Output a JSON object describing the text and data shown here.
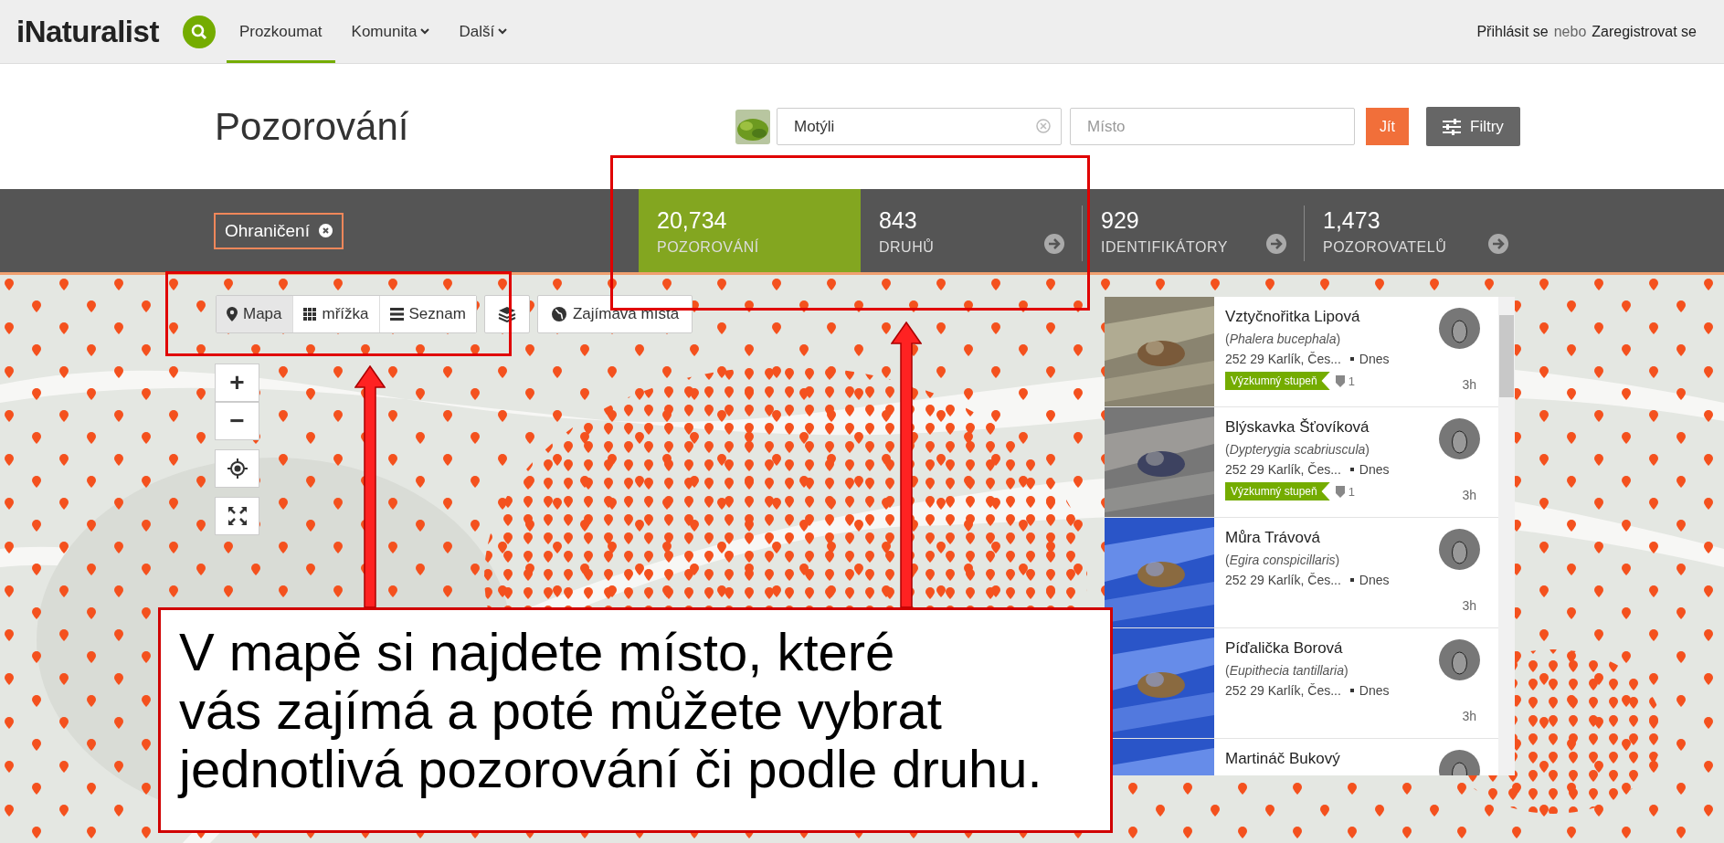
{
  "nav": {
    "logo": "iNaturalist",
    "items": [
      {
        "label": "Prozkoumat",
        "selected": true,
        "dropdown": false
      },
      {
        "label": "Komunita",
        "selected": false,
        "dropdown": true
      },
      {
        "label": "Další",
        "selected": false,
        "dropdown": true
      }
    ],
    "login": {
      "signin": "Přihlásit se",
      "or": "nebo",
      "signup": "Zaregistrovat se"
    }
  },
  "header": {
    "title": "Pozorování",
    "taxon": {
      "value": "Motýli"
    },
    "place": {
      "placeholder": "Místo"
    },
    "go": "Jít",
    "filters": "Filtry"
  },
  "filter_chip": {
    "label": "Ohraničení"
  },
  "stats": [
    {
      "number": "20,734",
      "label": "POZOROVÁNÍ",
      "selected": true
    },
    {
      "number": "843",
      "label": "DRUHŮ",
      "selected": false
    },
    {
      "number": "929",
      "label": "IDENTIFIKÁTORY",
      "selected": false
    },
    {
      "number": "1,473",
      "label": "POZOROVATELŮ",
      "selected": false
    }
  ],
  "view_tabs": [
    {
      "label": "Mapa",
      "kind": "pin",
      "selected": true
    },
    {
      "label": "mřížka",
      "kind": "grid",
      "selected": false
    },
    {
      "label": "Seznam",
      "kind": "list",
      "selected": false
    }
  ],
  "places_button": "Zajímavá místa",
  "zoom": {
    "in": "+",
    "out": "−"
  },
  "observations": [
    {
      "kind": "picture",
      "name": "Vztyčnořitka Lipová",
      "scientific": "(*Phalera bucephala*)",
      "place": "252 29 Karlík, Čes...",
      "date": "Dnes",
      "grade": "Výzkumný stupeň",
      "ids": "1",
      "time": "3h"
    },
    {
      "kind": "picture",
      "name": "Blýskavka Šťovíková",
      "scientific": "(*Dypterygia scabriuscula*)",
      "place": "252 29 Karlík, Čes...",
      "date": "Dnes",
      "grade": "Výzkumný stupeň",
      "ids": "1",
      "time": "3h"
    },
    {
      "kind": "picture",
      "name": "Můra Trávová",
      "scientific": "(*Egira conspicillaris*)",
      "place": "252 29 Karlík, Čes...",
      "date": "Dnes",
      "time": "3h"
    },
    {
      "kind": "picture",
      "name": "Píďalička Borová",
      "scientific": "(*Eupithecia tantillaria*)",
      "place": "252 29 Karlík, Čes...",
      "date": "Dnes",
      "time": "3h"
    },
    {
      "kind": "picture",
      "name": "Martináč Bukový"
    }
  ],
  "annotation": {
    "lines": [
      "V mapě si najdete místo, které",
      "vás zajímá a poté můžete vybrat",
      "jednotlivá pozorování či podle druhu."
    ]
  }
}
